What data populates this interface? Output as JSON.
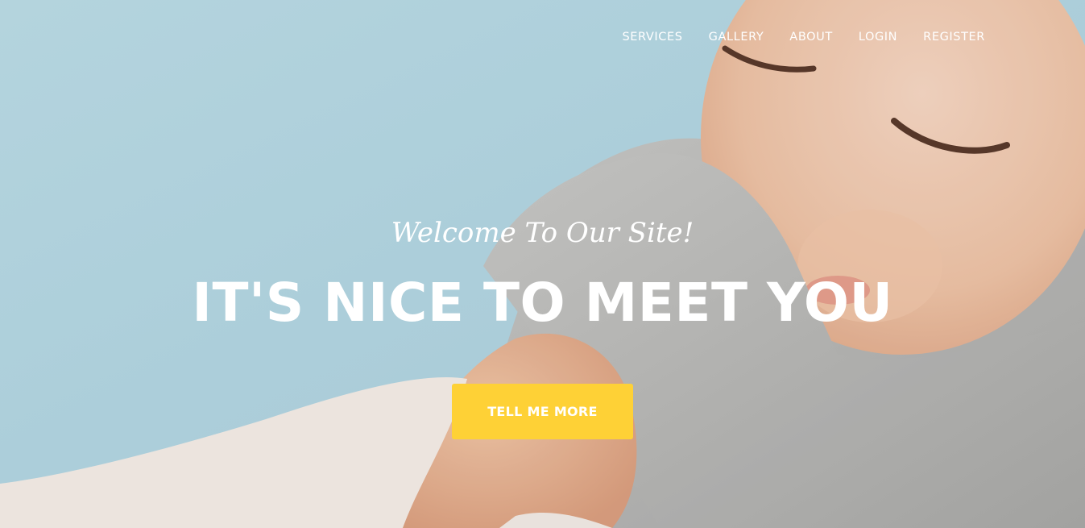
{
  "nav": {
    "items": [
      {
        "label": "SERVICES"
      },
      {
        "label": "GALLERY"
      },
      {
        "label": "ABOUT"
      },
      {
        "label": "LOGIN"
      },
      {
        "label": "REGISTER"
      }
    ]
  },
  "hero": {
    "subheading": "Welcome To Our Site!",
    "heading": "IT'S NICE TO MEET YOU",
    "button_label": "TELL ME MORE",
    "background_image": "baby-photo"
  },
  "colors": {
    "accent": "#fed136",
    "text": "#ffffff",
    "background": "#b9dbe5"
  }
}
